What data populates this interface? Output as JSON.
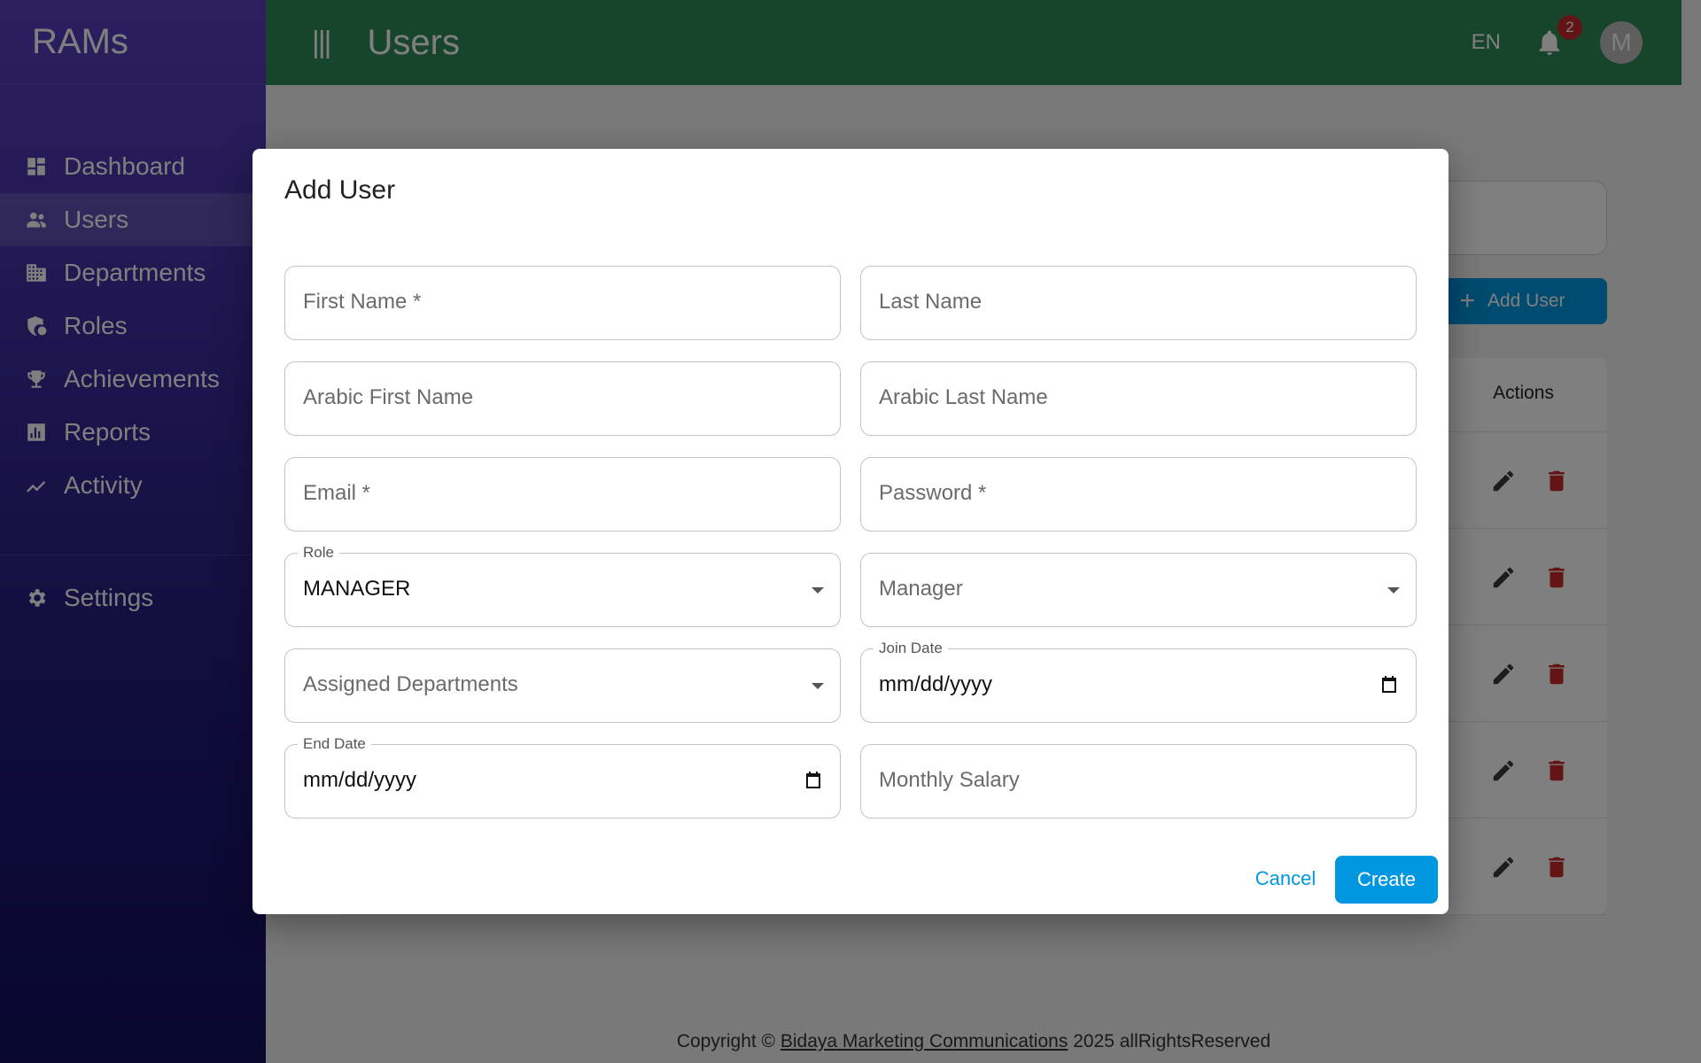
{
  "app": {
    "brand": "RAMs"
  },
  "sidebar": {
    "items": [
      {
        "label": "Dashboard",
        "icon": "dashboard-icon"
      },
      {
        "label": "Users",
        "icon": "users-icon",
        "active": true
      },
      {
        "label": "Departments",
        "icon": "building-icon"
      },
      {
        "label": "Roles",
        "icon": "shield-icon"
      },
      {
        "label": "Achievements",
        "icon": "trophy-icon"
      },
      {
        "label": "Reports",
        "icon": "bar-chart-icon"
      },
      {
        "label": "Activity",
        "icon": "trend-icon"
      }
    ],
    "settings": {
      "label": "Settings",
      "icon": "gear-icon"
    }
  },
  "topbar": {
    "menu_icon": "|||",
    "title": "Users",
    "language": "EN",
    "notification_count": "2",
    "avatar_initial": "M"
  },
  "page": {
    "add_user_label": "Add User",
    "table": {
      "actions_header": "Actions",
      "row_count": 5
    }
  },
  "modal": {
    "title": "Add User",
    "fields": {
      "first_name": {
        "placeholder": "First Name *"
      },
      "last_name": {
        "placeholder": "Last Name"
      },
      "arabic_first_name": {
        "placeholder": "Arabic First Name"
      },
      "arabic_last_name": {
        "placeholder": "Arabic Last Name"
      },
      "email": {
        "placeholder": "Email *"
      },
      "password": {
        "placeholder": "Password *"
      },
      "role": {
        "label": "Role",
        "value": "MANAGER"
      },
      "manager": {
        "placeholder": "Manager"
      },
      "assigned_departments": {
        "placeholder": "Assigned Departments"
      },
      "join_date": {
        "label": "Join Date",
        "value": "mm/dd/yyyy"
      },
      "end_date": {
        "label": "End Date",
        "value": "mm/dd/yyyy"
      },
      "monthly_salary": {
        "placeholder": "Monthly Salary"
      }
    },
    "cancel_label": "Cancel",
    "create_label": "Create"
  },
  "footer": {
    "prefix": "Copyright ©",
    "company": "Bidaya Marketing Communications",
    "suffix": "2025 allRightsReserved"
  },
  "colors": {
    "topbar": "#2e8b57",
    "primary": "#0096e0",
    "danger": "#c62828",
    "sidebar_top": "#5a3fc0",
    "sidebar_bottom": "#120f5c"
  }
}
